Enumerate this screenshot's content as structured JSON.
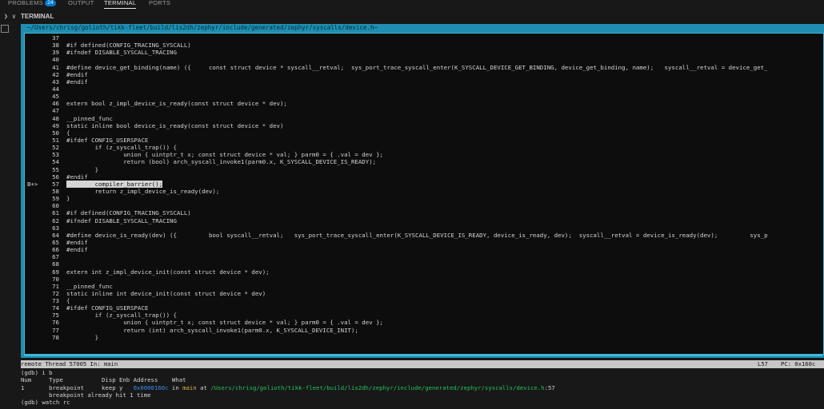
{
  "panel_tabs": [
    {
      "label": "PROBLEMS",
      "badge": "24"
    },
    {
      "label": "OUTPUT"
    },
    {
      "label": "TERMINAL",
      "active": true
    },
    {
      "label": "PORTS"
    }
  ],
  "section_title": "TERMINAL",
  "gdb_tui": {
    "source_path": "/Users/chrisg/golioth/tikk-fleet/build/lis2dh/zephyr/include/generated/zephyr/syscalls/device.h",
    "breakpoint_marker": "B+>",
    "current_line": "57",
    "lines": [
      {
        "n": "37",
        "t": ""
      },
      {
        "n": "38",
        "t": "#if defined(CONFIG_TRACING_SYSCALL)"
      },
      {
        "n": "39",
        "t": "#ifndef DISABLE_SYSCALL_TRACING"
      },
      {
        "n": "40",
        "t": ""
      },
      {
        "n": "41",
        "t": "#define device_get_binding(name) ({     const struct device * syscall__retval;  sys_port_trace_syscall_enter(K_SYSCALL_DEVICE_GET_BINDING, device_get_binding, name);   syscall__retval = device_get_"
      },
      {
        "n": "42",
        "t": "#endif"
      },
      {
        "n": "43",
        "t": "#endif"
      },
      {
        "n": "44",
        "t": ""
      },
      {
        "n": "45",
        "t": ""
      },
      {
        "n": "46",
        "t": "extern bool z_impl_device_is_ready(const struct device * dev);"
      },
      {
        "n": "47",
        "t": ""
      },
      {
        "n": "48",
        "t": "__pinned_func"
      },
      {
        "n": "49",
        "t": "static inline bool device_is_ready(const struct device * dev)"
      },
      {
        "n": "50",
        "t": "{"
      },
      {
        "n": "51",
        "t": "#ifdef CONFIG_USERSPACE"
      },
      {
        "n": "52",
        "t": "        if (z_syscall_trap()) {"
      },
      {
        "n": "53",
        "t": "                union { uintptr_t x; const struct device * val; } parm0 = { .val = dev };"
      },
      {
        "n": "54",
        "t": "                return (bool) arch_syscall_invoke1(parm0.x, K_SYSCALL_DEVICE_IS_READY);"
      },
      {
        "n": "55",
        "t": "        }"
      },
      {
        "n": "56",
        "t": "#endif"
      },
      {
        "n": "57",
        "t": "        compiler_barrier();"
      },
      {
        "n": "58",
        "t": "        return z_impl_device_is_ready(dev);"
      },
      {
        "n": "59",
        "t": "}"
      },
      {
        "n": "60",
        "t": ""
      },
      {
        "n": "61",
        "t": "#if defined(CONFIG_TRACING_SYSCALL)"
      },
      {
        "n": "62",
        "t": "#ifndef DISABLE_SYSCALL_TRACING"
      },
      {
        "n": "63",
        "t": ""
      },
      {
        "n": "64",
        "t": "#define device_is_ready(dev) ({         bool syscall__retval;   sys_port_trace_syscall_enter(K_SYSCALL_DEVICE_IS_READY, device_is_ready, dev);  syscall__retval = device_is_ready(dev);         sys_p"
      },
      {
        "n": "65",
        "t": "#endif"
      },
      {
        "n": "66",
        "t": "#endif"
      },
      {
        "n": "67",
        "t": ""
      },
      {
        "n": "68",
        "t": ""
      },
      {
        "n": "69",
        "t": "extern int z_impl_device_init(const struct device * dev);"
      },
      {
        "n": "70",
        "t": ""
      },
      {
        "n": "71",
        "t": "__pinned_func"
      },
      {
        "n": "72",
        "t": "static inline int device_init(const struct device * dev)"
      },
      {
        "n": "73",
        "t": "{"
      },
      {
        "n": "74",
        "t": "#ifdef CONFIG_USERSPACE"
      },
      {
        "n": "75",
        "t": "        if (z_syscall_trap()) {"
      },
      {
        "n": "76",
        "t": "                union { uintptr_t x; const struct device * val; } parm0 = { .val = dev };"
      },
      {
        "n": "77",
        "t": "                return (int) arch_syscall_invoke1(parm0.x, K_SYSCALL_DEVICE_INIT);"
      },
      {
        "n": "78",
        "t": "        }"
      }
    ],
    "status_left": "remote Thread 57005 In: main",
    "status_line": "L57",
    "status_pc": "PC: 0x160c"
  },
  "console": {
    "l1": "(gdb) i b",
    "l2": "Num     Type           Disp Enb Address    What",
    "l3_a": "1       breakpoint     keep y   ",
    "l3_addr": "0x0000160c",
    "l3_in": " in ",
    "l3_fn": "main",
    "l3_at": " at ",
    "l3_path": "/Users/chrisg/golioth/tikk-fleet/build/lis2dh/zephyr/include/generated/zephyr/syscalls/device.h",
    "l3_b": ":57",
    "l4": "        breakpoint already hit 1 time",
    "l5": "(gdb) watch rc"
  },
  "colors": {
    "tui_border": "#1e8fb0",
    "tui_inner_border": "#3fb8d6",
    "address": "#3b8eea",
    "function": "#d7ba3d",
    "path": "#23c45c"
  }
}
